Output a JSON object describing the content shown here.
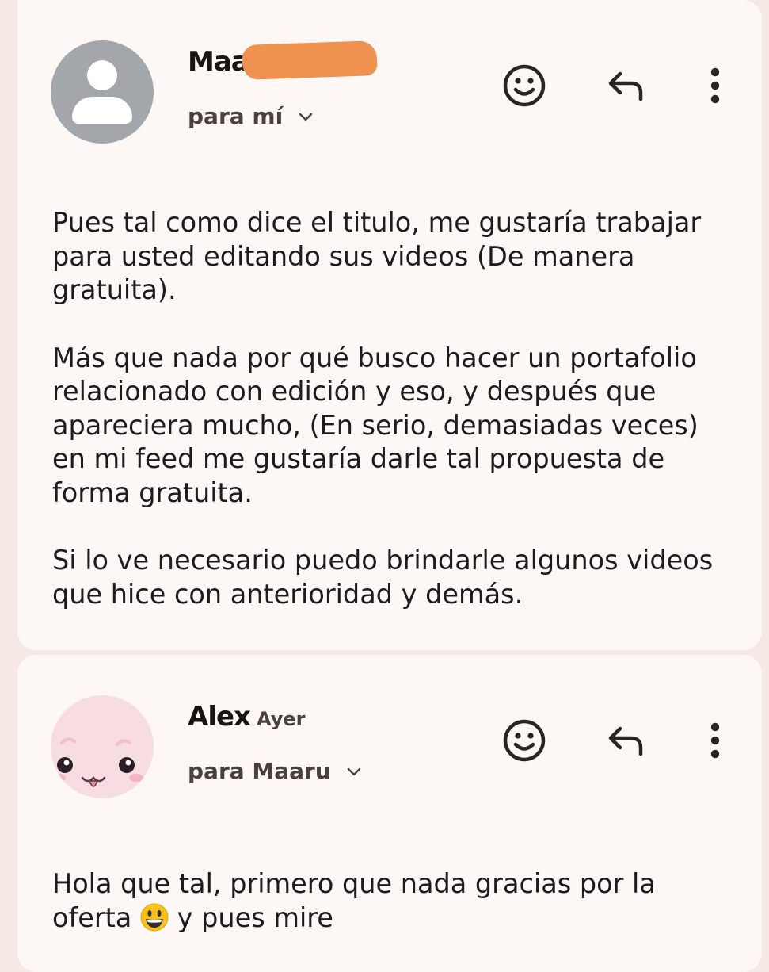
{
  "messages": [
    {
      "sender": "Maa",
      "recipient": "para mí",
      "body": [
        "Pues tal como dice el titulo, me gustaría trabajar\npara usted editando sus videos (De manera\ngratuita).",
        "Más que nada por qué busco hacer un portafolio\nrelacionado con edición y eso, y después que\napareciera mucho, (En serio, demasiadas veces)\nen mi feed me gustaría darle tal propuesta de\nforma gratuita.",
        "Si lo ve necesario puedo brindarle algunos videos\nque hice con anterioridad y demás."
      ],
      "icons": [
        "person-icon",
        "emoji-reaction-icon",
        "reply-icon",
        "more-vert-icon"
      ]
    },
    {
      "sender": "Alex",
      "time": "Ayer",
      "recipient": "para Maaru",
      "body_before_emoji": "Hola que tal, primero que nada gracias por la\noferta ",
      "body_after_emoji": " y pues mire",
      "icons": [
        "bunny-avatar",
        "emoji-reaction-icon",
        "reply-icon",
        "more-vert-icon"
      ]
    }
  ],
  "colors": {
    "page_background": "#f6e9e5",
    "card_background": "#fdf8f6",
    "redaction": "#f0924f",
    "default_avatar": "#a3a7ab",
    "bunny_avatar": "#f7dde1",
    "text": "#1f1b1a"
  }
}
